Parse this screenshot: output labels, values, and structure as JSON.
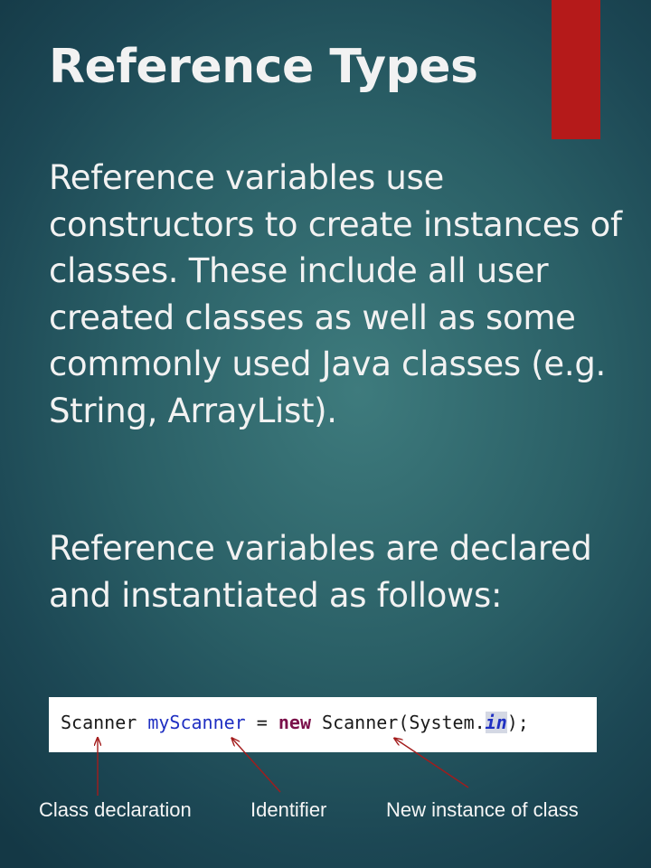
{
  "slide": {
    "title": "Reference Types",
    "paragraph1": "Reference variables use constructors to create instances of classes. These include all user created classes as well as some commonly used Java classes (e.g. String, ArrayList).",
    "paragraph2": "Reference variables are declared and instantiated as follows:",
    "accent_color": "#b51a1a"
  },
  "code": {
    "type_name": "Scanner",
    "identifier": "myScanner",
    "equals": "=",
    "keyword": "new",
    "constructor_call": "Scanner(System.",
    "field": "in",
    "closing": ");"
  },
  "annotations": {
    "class_declaration": "Class declaration",
    "identifier": "Identifier",
    "new_instance": "New instance of class",
    "arrow_color": "#a31c1c"
  }
}
